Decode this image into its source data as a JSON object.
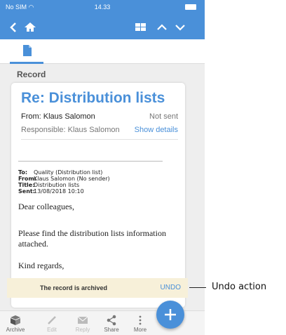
{
  "status_bar": {
    "carrier": "No SIM",
    "time": "14.33"
  },
  "navbar": {
    "icons": [
      "back-icon",
      "home-icon",
      "grid-icon",
      "chevron-up-icon",
      "chevron-down-icon"
    ]
  },
  "tabs": [
    {
      "icon": "document-icon",
      "selected": true
    }
  ],
  "section": {
    "title": "Record"
  },
  "record": {
    "subject": "Re: Distribution lists",
    "from": "From: Klaus Salomon",
    "status": "Not sent",
    "responsible": "Responsible: Klaus Salomon",
    "show_details": "Show details"
  },
  "email": {
    "to_label": "To:",
    "to": "Quality (Distribution list)",
    "from_label": "From:",
    "from": "Klaus Salomon (No sender)",
    "title_label": "Title:",
    "title": "Distribution lists",
    "sent_label": "Sent:",
    "sent": "13/08/2018 10:10",
    "greeting": "Dear colleagues,",
    "body": "Please find the distribution lists information attached.",
    "closing": "Kind regards,"
  },
  "snackbar": {
    "message": "The record is archived",
    "action": "UNDO"
  },
  "bottom_bar": [
    {
      "label": "Archive",
      "icon": "archive-icon",
      "enabled": true
    },
    {
      "label": "Edit",
      "icon": "pencil-icon",
      "enabled": false
    },
    {
      "label": "Reply",
      "icon": "envelope-icon",
      "enabled": false
    },
    {
      "label": "Share",
      "icon": "share-icon",
      "enabled": true
    },
    {
      "label": "More",
      "icon": "more-vertical-icon",
      "enabled": true
    }
  ],
  "fab": {
    "icon": "plus-icon"
  },
  "callout": {
    "label": "Undo action"
  },
  "colors": {
    "accent": "#4a90d9",
    "snackbar_bg": "#f7f0d9",
    "background": "#eeeeee"
  }
}
